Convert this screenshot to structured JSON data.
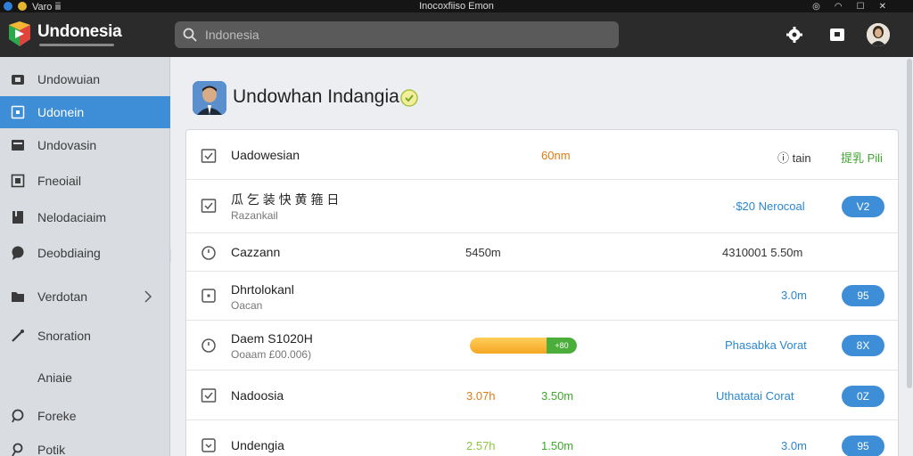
{
  "os_bar": {
    "left_text": "Varo  ⅲ",
    "title": "Inocoxfiiso Emon"
  },
  "header": {
    "brand": "Undonesia",
    "search_placeholder": "Indonesia"
  },
  "sidebar": {
    "items": [
      {
        "label": "Undowuian",
        "icon": "video-icon"
      },
      {
        "label": "Udonein",
        "icon": "square-icon",
        "active": true
      },
      {
        "label": "Undovasin",
        "icon": "box-icon"
      },
      {
        "label": "Fneoiail",
        "icon": "frame-icon"
      },
      {
        "label": "Nelodaciaim",
        "icon": "bookmark-icon"
      },
      {
        "label": "Deobdiaing",
        "icon": "chat-icon"
      },
      {
        "label": "Verdotan",
        "icon": "folder-icon",
        "chevron": true
      },
      {
        "label": "Snoration",
        "icon": "pen-icon"
      },
      {
        "label": "Aniaie",
        "icon": ""
      },
      {
        "label": "Foreke",
        "icon": "location-icon"
      },
      {
        "label": "Potik",
        "icon": "pin-icon"
      }
    ]
  },
  "page": {
    "title": "Undowhan Indangia"
  },
  "rows": [
    {
      "title": "Uadowesian",
      "subtitle": "",
      "col_a": "60nm",
      "col_a_color": "orange",
      "col_b": "",
      "col_c": "ⓘ  tain",
      "col_d": "提乳 Pili",
      "pill": ""
    },
    {
      "title": "瓜 乞 装 快 黄 箍 日",
      "subtitle": "Razankail",
      "col_a": "",
      "col_b": "",
      "col_c": "·$20 Nerocoal",
      "pill": "V2"
    },
    {
      "title": "Cazzann",
      "subtitle": "",
      "col_a": "5450m",
      "col_b": "",
      "col_c": "4310001 5.50m",
      "pill": ""
    },
    {
      "title": "Dhrtolokanl",
      "subtitle": "Oacan",
      "col_a": "",
      "col_b": "",
      "col_c": "3.0m",
      "pill": "95"
    },
    {
      "title": "Daem S1020H",
      "subtitle": "Ooaam £00.006)",
      "progress_fraction": 0.72,
      "progress_label": "+80",
      "col_c": "Phasabka Vorat",
      "pill": "8X"
    },
    {
      "title": "Nadoosia",
      "subtitle": "",
      "col_a": "3.07h",
      "col_b": "3.50m",
      "col_c": "Uthatatai Corat",
      "pill": "0Z"
    },
    {
      "title": "Undengia",
      "subtitle": "",
      "col_a": "2.57h",
      "col_b": "1.50m",
      "col_c": "3.0m",
      "pill": "95"
    }
  ],
  "colors": {
    "accent": "#3d8ed6",
    "header_bg": "#2b2b2b",
    "sidebar_bg": "#d9dde2",
    "orange": "#e07b12",
    "green": "#3fa62f"
  }
}
